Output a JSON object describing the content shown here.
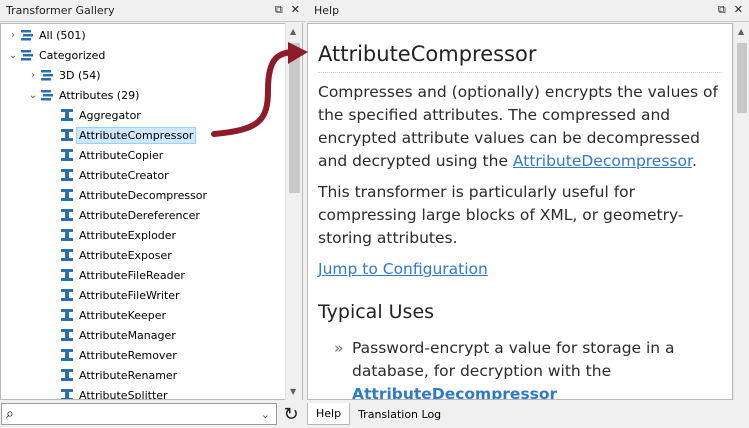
{
  "gallery_panel": {
    "title": "Transformer Gallery",
    "tree": [
      {
        "label": "All (501)",
        "caret": "›",
        "indent": 0,
        "icon": "stack-icon"
      },
      {
        "label": "Categorized",
        "caret": "⌄",
        "indent": 0,
        "icon": "stack-icon"
      },
      {
        "label": "3D (54)",
        "caret": "›",
        "indent": 1,
        "icon": "stack-icon"
      },
      {
        "label": "Attributes (29)",
        "caret": "⌄",
        "indent": 1,
        "icon": "stack-icon"
      },
      {
        "label": "Aggregator",
        "indent": 2,
        "icon": "transformer-icon"
      },
      {
        "label": "AttributeCompressor",
        "indent": 2,
        "icon": "transformer-icon",
        "selected": true
      },
      {
        "label": "AttributeCopier",
        "indent": 2,
        "icon": "transformer-icon"
      },
      {
        "label": "AttributeCreator",
        "indent": 2,
        "icon": "transformer-icon"
      },
      {
        "label": "AttributeDecompressor",
        "indent": 2,
        "icon": "transformer-icon"
      },
      {
        "label": "AttributeDereferencer",
        "indent": 2,
        "icon": "transformer-icon"
      },
      {
        "label": "AttributeExploder",
        "indent": 2,
        "icon": "transformer-icon"
      },
      {
        "label": "AttributeExposer",
        "indent": 2,
        "icon": "transformer-icon"
      },
      {
        "label": "AttributeFileReader",
        "indent": 2,
        "icon": "transformer-icon"
      },
      {
        "label": "AttributeFileWriter",
        "indent": 2,
        "icon": "transformer-icon"
      },
      {
        "label": "AttributeKeeper",
        "indent": 2,
        "icon": "transformer-icon"
      },
      {
        "label": "AttributeManager",
        "indent": 2,
        "icon": "transformer-icon"
      },
      {
        "label": "AttributeRemover",
        "indent": 2,
        "icon": "transformer-icon"
      },
      {
        "label": "AttributeRenamer",
        "indent": 2,
        "icon": "transformer-icon"
      },
      {
        "label": "AttributeSplitter",
        "indent": 2,
        "icon": "transformer-icon"
      }
    ],
    "search_placeholder": ""
  },
  "help_panel": {
    "title": "Help",
    "heading": "AttributeCompressor",
    "para1_text": "Compresses and (optionally) encrypts the values of the specified attributes. The compressed and encrypted attribute values can be decompressed and decrypted using the ",
    "para1_link": "AttributeDecompressor",
    "para1_end": ".",
    "para2": "This transformer is particularly useful for compressing large blocks of XML, or geometry-storing attributes.",
    "jump_link": "Jump to Configuration",
    "typical_uses": "Typical Uses",
    "bullet1_text": "Password-encrypt a value for storage in a database, for decryption with the ",
    "bullet1_link": "AttributeDecompressor",
    "bullet_mark": "»",
    "tabs": [
      "Help",
      "Translation Log"
    ]
  },
  "icons": {
    "float": "⧉",
    "close": "✕",
    "refresh": "↻",
    "search": "⌕",
    "dropdown": "⌄"
  },
  "colors": {
    "accent_link": "#2f7ac8",
    "selection": "#cde8ff",
    "annotation_arrow": "#8e1b2a",
    "icon_blue": "#2a6fb0"
  }
}
